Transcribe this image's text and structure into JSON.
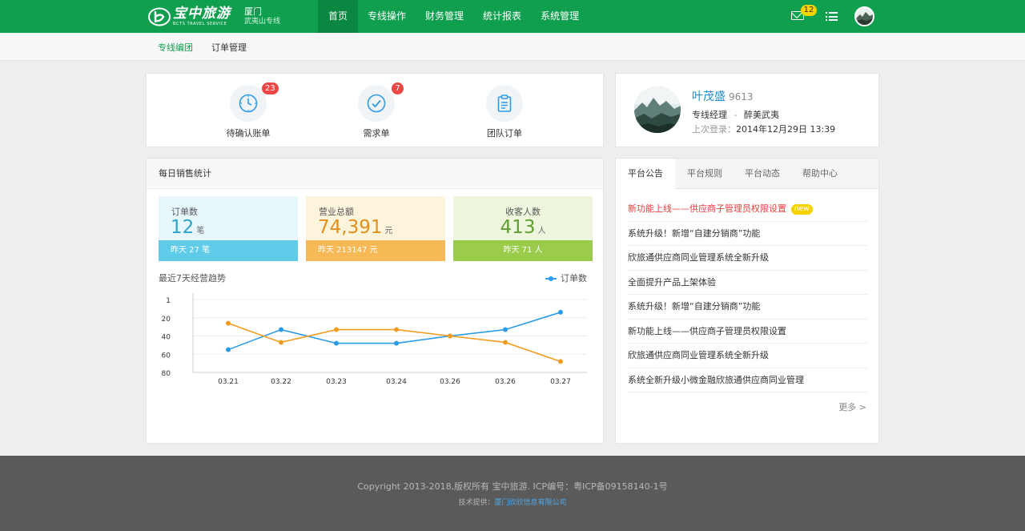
{
  "header": {
    "logo_cn": "宝中旅游",
    "logo_en": "BCTS TRAVEL SERVICE",
    "city": "厦门",
    "line_name": "武夷山专线",
    "nav": [
      {
        "label": "首页",
        "active": true
      },
      {
        "label": "专线操作"
      },
      {
        "label": "财务管理"
      },
      {
        "label": "统计报表"
      },
      {
        "label": "系统管理"
      }
    ],
    "mail_count": "12",
    "mail_icon": "mail-icon",
    "menu_icon": "list-icon"
  },
  "subnav": {
    "items": [
      {
        "label": "专线编团",
        "active": true
      },
      {
        "label": "订单管理"
      }
    ]
  },
  "quick_links": [
    {
      "label": "待确认账单",
      "badge": "23",
      "icon": "clock-icon"
    },
    {
      "label": "需求单",
      "badge": "7",
      "icon": "check-circle-icon"
    },
    {
      "label": "团队订单",
      "icon": "clipboard-icon"
    }
  ],
  "profile": {
    "name": "叶茂盛",
    "id": "9613",
    "role": "专线经理",
    "sep": "-",
    "company": "醉美武夷",
    "last_login_label": "上次登录：",
    "last_login": "2014年12月29日 13:39"
  },
  "sales": {
    "title": "每日销售统计",
    "stats": [
      {
        "label": "订单数",
        "value": "12",
        "unit": "笔",
        "yesterday": "昨天 27 笔",
        "color": "#2ba5c8",
        "bg": "#e8f7fc",
        "bar": "#5ecbe8"
      },
      {
        "label": "营业总额",
        "value": "74,391",
        "unit": "元",
        "yesterday": "昨天 213147 元",
        "color": "#e2901b",
        "bg": "#fdf4dc",
        "bar": "#f7b955"
      },
      {
        "label": "收客人数",
        "value": "413",
        "unit": "人",
        "yesterday": "昨天 71 人",
        "color": "#5da031",
        "bg": "#eef7de",
        "bar": "#9bcb4b"
      }
    ],
    "trend_title": "最近7天经营趋势",
    "legend_label": "订单数"
  },
  "chart_data": {
    "type": "line",
    "categories": [
      "03.21",
      "03.22",
      "03.23",
      "03.24",
      "03.26",
      "03.26",
      "03.27"
    ],
    "y_ticks": [
      "1",
      "20",
      "40",
      "60",
      "80"
    ],
    "ylim": [
      0,
      80
    ],
    "y_inverted": true,
    "grid": true,
    "legend_position": "top-right",
    "series": [
      {
        "name": "订单数",
        "color": "#2b9be7",
        "values": [
          55,
          33,
          48,
          48,
          40,
          33,
          14
        ],
        "markers": true
      },
      {
        "color": "#f39c1f",
        "values": [
          26,
          47,
          33,
          33,
          40,
          47,
          68
        ],
        "markers": true
      }
    ]
  },
  "notices": {
    "tabs": [
      {
        "label": "平台公告",
        "active": true
      },
      {
        "label": "平台规则"
      },
      {
        "label": "平台动态"
      },
      {
        "label": "帮助中心"
      }
    ],
    "items": [
      {
        "text": "新功能上线——供应商子管理员权限设置",
        "hot": true,
        "tag": "new"
      },
      {
        "text": "系统升级！新增“自建分销商”功能"
      },
      {
        "text": "欣旅通供应商同业管理系统全新升级"
      },
      {
        "text": "全面提升产品上架体验"
      },
      {
        "text": "系统升级！新增“自建分销商”功能"
      },
      {
        "text": "新功能上线——供应商子管理员权限设置"
      },
      {
        "text": "欣旅通供应商同业管理系统全新升级"
      },
      {
        "text": "系统全新升级小微金融欣旅通供应商同业管理"
      }
    ],
    "more": "更多 >"
  },
  "footer": {
    "copyright": "Copyright 2013-2018,版权所有 宝中旅游. ICP编号：粤ICP备09158140-1号",
    "tech_label": "技术提供：",
    "tech_company": "厦门欣欣信息有限公司"
  }
}
